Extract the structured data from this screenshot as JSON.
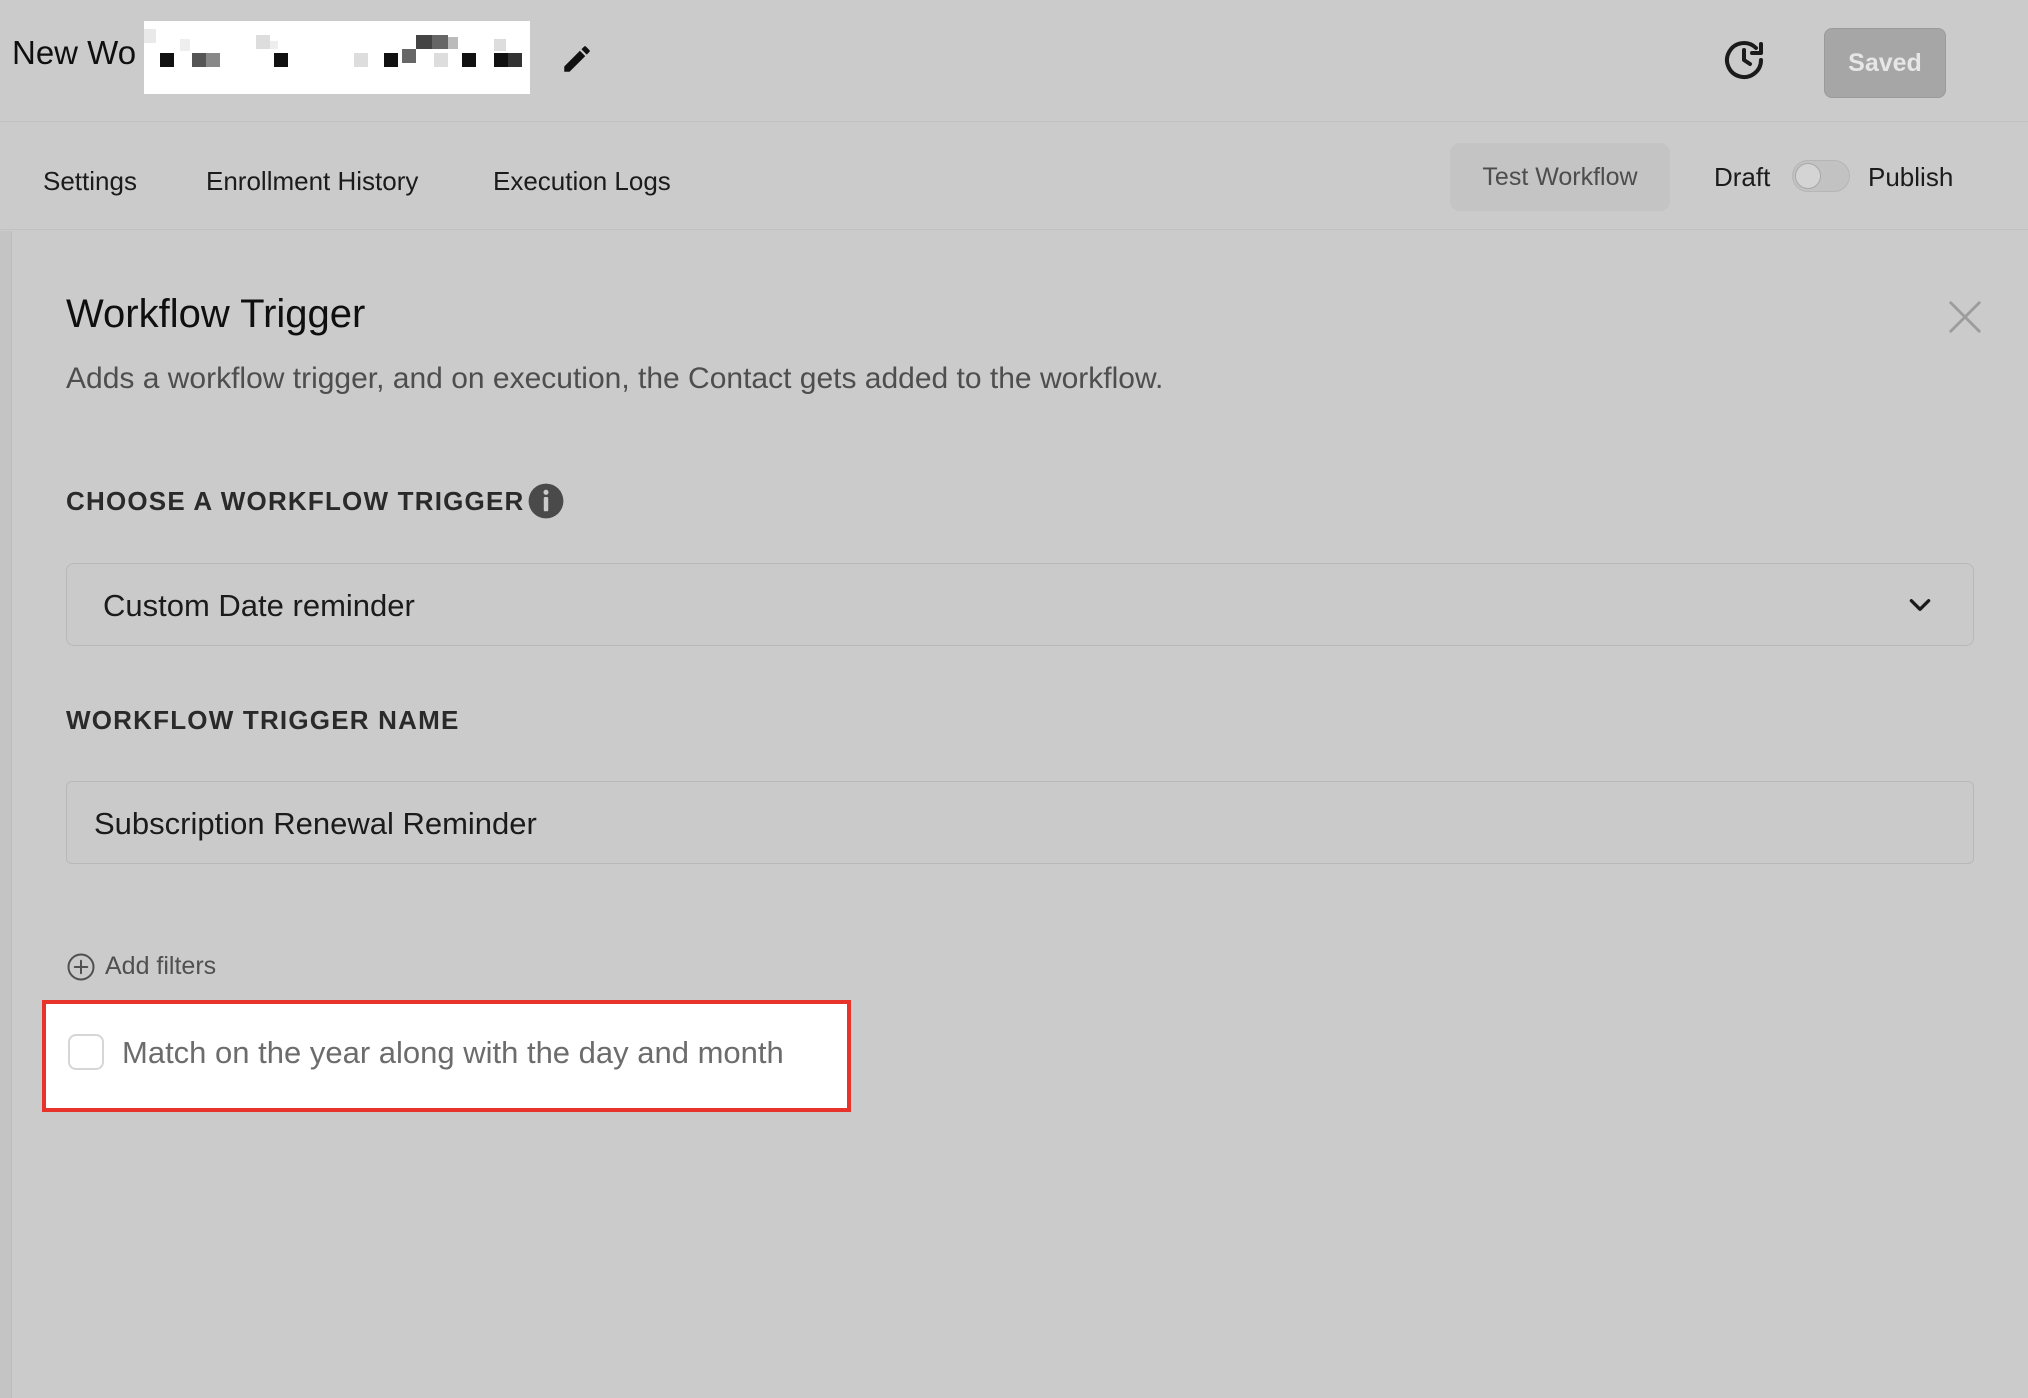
{
  "header": {
    "title": "New Wo",
    "save_status": "Saved",
    "icons": {
      "edit": "pencil-icon",
      "history": "clock-history-icon"
    }
  },
  "tabs": [
    {
      "label": "Settings"
    },
    {
      "label": "Enrollment History"
    },
    {
      "label": "Execution Logs"
    }
  ],
  "actions": {
    "test_workflow": "Test Workflow",
    "draft_label": "Draft",
    "publish_label": "Publish",
    "publish_toggle_on": false
  },
  "panel": {
    "title": "Workflow Trigger",
    "description": "Adds a workflow trigger, and on execution, the Contact gets added to the workflow.",
    "trigger_section_label": "CHOOSE A WORKFLOW TRIGGER",
    "trigger_selected": "Custom Date reminder",
    "name_section_label": "WORKFLOW TRIGGER NAME",
    "name_value": "Subscription Renewal Reminder",
    "add_filters_label": "Add filters",
    "match_year_label": "Match on the year along with the day and month",
    "match_year_checked": false
  },
  "colors": {
    "background": "#cbcbcb",
    "highlight_border": "#e8322c",
    "saved_button": "#a6a6a6"
  }
}
